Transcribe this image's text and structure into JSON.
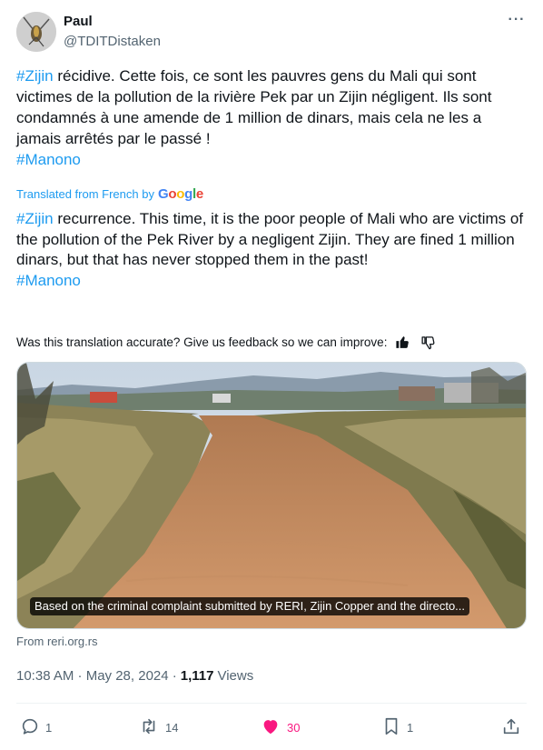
{
  "author": {
    "name": "Paul",
    "handle": "@TDITDistaken"
  },
  "post": {
    "original": {
      "hashtag1": "#Zijin",
      "text": " récidive.  Cette fois, ce sont les pauvres gens du Mali qui sont victimes de la pollution de la rivière Pek par un Zijin négligent.  Ils sont condamnés à une amende de 1 million de dinars, mais cela ne les a jamais arrêtés par le passé !",
      "hashtag2": "#Manono"
    },
    "translated_from": "Translated from French by",
    "translator_brand": "Google",
    "translation": {
      "hashtag1": "#Zijin",
      "text": " recurrence. This time, it is the poor people of Mali who are victims of the pollution of the Pek River by a negligent Zijin. They are fined 1 million dinars, but that has never stopped them in the past!",
      "hashtag2": "#Manono"
    },
    "feedback_prompt": "Was this translation accurate? Give us feedback so we can improve:",
    "media_caption": "Based on the criminal complaint submitted by RERI, Zijin Copper and the directo...",
    "source": "From reri.org.rs",
    "timestamp": "10:38 AM · May 28, 2024 ·",
    "views_count": "1,117",
    "views_label": "Views"
  },
  "actions": {
    "replies": "1",
    "reposts": "14",
    "likes": "30",
    "bookmarks": "1"
  },
  "colors": {
    "accent": "#1d9bf0",
    "like": "#f91880",
    "muted": "#536471",
    "text": "#0f1419"
  },
  "icons": [
    "more-icon",
    "thumbs-up-icon",
    "thumbs-down-icon",
    "reply-icon",
    "repost-icon",
    "heart-icon",
    "bookmark-icon",
    "share-icon"
  ]
}
